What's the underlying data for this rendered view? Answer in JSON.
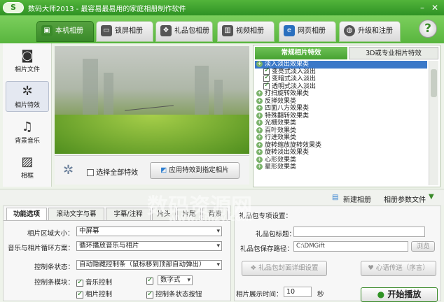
{
  "window": {
    "title": "数码大师2013  - 最容易最易用的家庭相册制作软件",
    "logo_text": "S"
  },
  "main_tabs": [
    {
      "label": "本机相册",
      "icon": "monitor-photo-icon"
    },
    {
      "label": "锁屏相册",
      "icon": "screen-icon"
    },
    {
      "label": "礼品包相册",
      "icon": "gift-icon"
    },
    {
      "label": "视频相册",
      "icon": "film-icon"
    },
    {
      "label": "网页相册",
      "icon": "ie-icon"
    },
    {
      "label": "升级和注册",
      "icon": "globe-icon"
    }
  ],
  "help_label": "?",
  "sidebar": [
    {
      "label": "相片文件",
      "icon": "camera-icon"
    },
    {
      "label": "相片特效",
      "icon": "effects-icon"
    },
    {
      "label": "背景音乐",
      "icon": "music-icon"
    },
    {
      "label": "相框",
      "icon": "frame-icon"
    }
  ],
  "preview_bar": {
    "select_all": "选择全部特效",
    "apply_button": "应用特效到指定相片"
  },
  "right_tabs": [
    "常规相片特效",
    "3D或专业相片特效"
  ],
  "effects": [
    {
      "label": "淡入淡出效果类",
      "group": true,
      "selected": true
    },
    {
      "label": "变亮式淡入淡出",
      "checked": true
    },
    {
      "label": "变暗式淡入淡出",
      "checked": true
    },
    {
      "label": "透明式淡入淡出",
      "checked": true
    },
    {
      "label": "打扫旋转效果类",
      "group": true
    },
    {
      "label": "反掸效果类",
      "group": true
    },
    {
      "label": "四面八方效果类",
      "group": true
    },
    {
      "label": "特殊翻转效果类",
      "group": true
    },
    {
      "label": "光栅效果类",
      "group": true
    },
    {
      "label": "百叶效果类",
      "group": true
    },
    {
      "label": "行进效果类",
      "group": true
    },
    {
      "label": "旋转缩放旋转效果类",
      "group": true
    },
    {
      "label": "旋转淡出效果类",
      "group": true
    },
    {
      "label": "心形效果类",
      "group": true
    },
    {
      "label": "星形效果类",
      "group": true
    }
  ],
  "mid_bar": {
    "new_album": "新建相册",
    "album_params": "相册参数文件"
  },
  "bottom_tabs": [
    "功能选项",
    "滚动文字与幕",
    "字幕/注释",
    "片头",
    "片尾",
    "背景"
  ],
  "options": {
    "area_size_label": "相片区域大小：",
    "area_size_value": "中屏幕",
    "music_mode_label": "音乐与相片循环方案：",
    "music_mode_value": "循环播放音乐与相片",
    "control_state_label": "控制条状态：",
    "control_state_value": "自动隐藏控制条（鼠标移到顶部自动弹出）",
    "control_module_label": "控制条模块：",
    "modules": [
      {
        "label": "音乐控制",
        "checked": true
      },
      {
        "label": "数字式",
        "checked": true,
        "select": true
      },
      {
        "label": "相片控制",
        "checked": true
      },
      {
        "label": "控制条状态按钮",
        "checked": true
      }
    ]
  },
  "gift_settings": {
    "title": "礼品包专项设置：",
    "title_label": "礼品包标题：",
    "title_value": "",
    "path_label": "礼品包保存路径：",
    "path_value": "C:\\DMGift",
    "browse": "浏览",
    "detail_button": "礼品包封面详细设置",
    "send_button": "心语传送（序言）",
    "time_label": "相片展示时间：",
    "time_value": "10",
    "time_unit": "秒",
    "play_button": "开始播放"
  },
  "watermark": {
    "text": "数码资源网",
    "sub": "www.smzy.com"
  }
}
